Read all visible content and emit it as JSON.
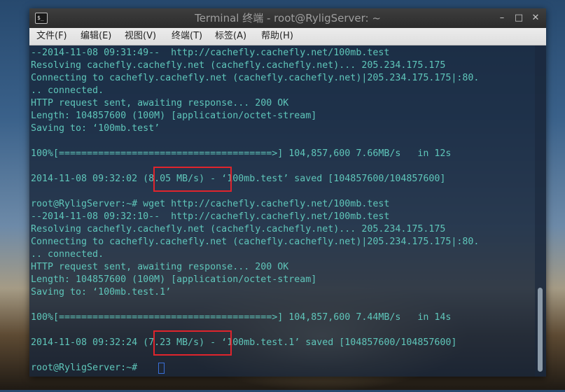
{
  "window": {
    "title": "Terminal 终端 - root@RyligServer: ~",
    "app_icon_glyph": "$_",
    "controls": {
      "minimize": "–",
      "maximize": "□",
      "close": "✕"
    }
  },
  "menubar": [
    "文件(F)",
    "编辑(E)",
    "视图(V)",
    "终端(T)",
    "标签(A)",
    "帮助(H)"
  ],
  "terminal": {
    "text_color": "#5fc6ba",
    "highlight_color": "#e0242c",
    "lines": [
      "--2014-11-08 09:31:49--  http://cachefly.cachefly.net/100mb.test",
      "Resolving cachefly.cachefly.net (cachefly.cachefly.net)... 205.234.175.175",
      "Connecting to cachefly.cachefly.net (cachefly.cachefly.net)|205.234.175.175|:80.",
      ".. connected.",
      "HTTP request sent, awaiting response... 200 OK",
      "Length: 104857600 (100M) [application/octet-stream]",
      "Saving to: ‘100mb.test’",
      "",
      "100%[======================================>] 104,857,600 7.66MB/s   in 12s",
      "",
      "2014-11-08 09:32:02 (8.05 MB/s) - ‘100mb.test’ saved [104857600/104857600]",
      "",
      "root@RyligServer:~# wget http://cachefly.cachefly.net/100mb.test",
      "--2014-11-08 09:32:10--  http://cachefly.cachefly.net/100mb.test",
      "Resolving cachefly.cachefly.net (cachefly.cachefly.net)... 205.234.175.175",
      "Connecting to cachefly.cachefly.net (cachefly.cachefly.net)|205.234.175.175|:80.",
      ".. connected.",
      "HTTP request sent, awaiting response... 200 OK",
      "Length: 104857600 (100M) [application/octet-stream]",
      "Saving to: ‘100mb.test.1’",
      "",
      "100%[======================================>] 104,857,600 7.44MB/s   in 14s",
      "",
      "2014-11-08 09:32:24 (7.23 MB/s) - ‘100mb.test.1’ saved [104857600/104857600]",
      "",
      "root@RyligServer:~# "
    ],
    "highlights": [
      {
        "line": 10,
        "text": "(8.05 MB/s)"
      },
      {
        "line": 23,
        "text": "(7.23 MB/s)"
      }
    ]
  }
}
